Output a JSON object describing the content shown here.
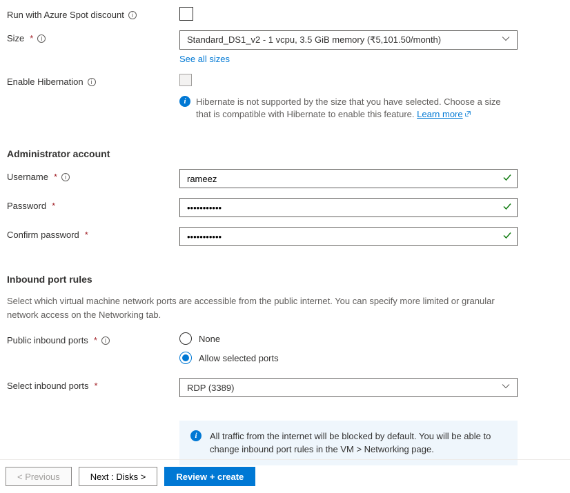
{
  "spot": {
    "label": "Run with Azure Spot discount"
  },
  "size": {
    "label": "Size",
    "value": "Standard_DS1_v2 - 1 vcpu, 3.5 GiB memory (₹5,101.50/month)",
    "see_all_link": "See all sizes"
  },
  "hibernation": {
    "label": "Enable Hibernation",
    "msg_pre": "Hibernate is not supported by the size that you have selected. Choose a size that is compatible with Hibernate to enable this feature.  ",
    "learn_more": "Learn more"
  },
  "admin": {
    "heading": "Administrator account",
    "username_label": "Username",
    "username_value": "rameez",
    "password_label": "Password",
    "password_value": "•••••••••••",
    "confirm_label": "Confirm password",
    "confirm_value": "•••••••••••"
  },
  "inbound": {
    "heading": "Inbound port rules",
    "desc": "Select which virtual machine network ports are accessible from the public internet. You can specify more limited or granular network access on the Networking tab.",
    "public_label": "Public inbound ports",
    "option_none": "None",
    "option_allow": "Allow selected ports",
    "select_label": "Select inbound ports",
    "select_value": "RDP (3389)",
    "callout": "All traffic from the internet will be blocked by default. You will be able to change inbound port rules in the VM > Networking page."
  },
  "buttons": {
    "prev": "< Previous",
    "next": "Next : Disks >",
    "review": "Review + create"
  }
}
